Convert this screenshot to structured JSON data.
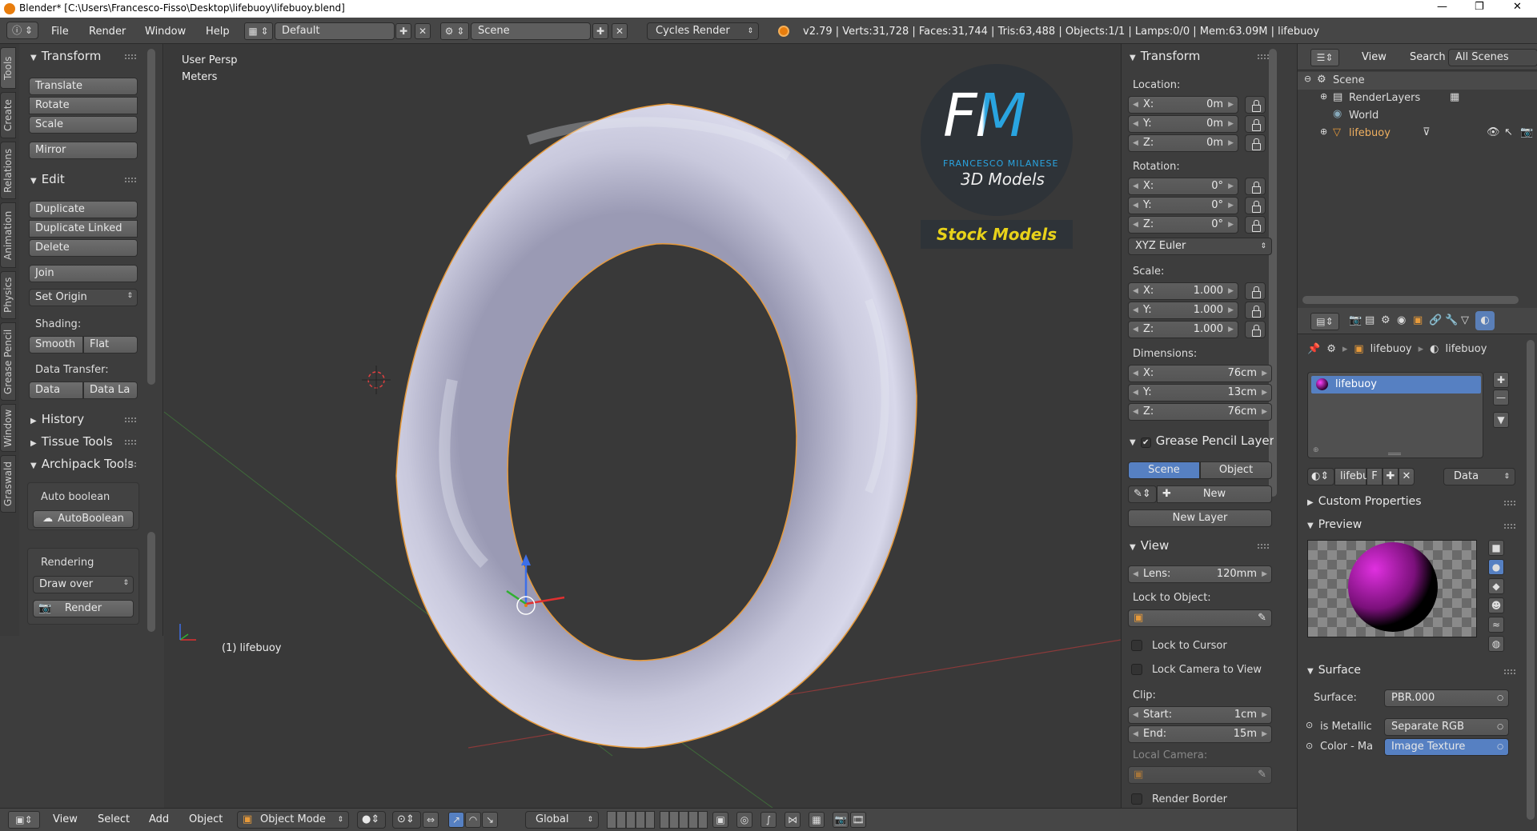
{
  "window": {
    "title": "Blender* [C:\\Users\\Francesco-Fisso\\Desktop\\lifebuoy\\lifebuoy.blend]",
    "min": "—",
    "max": "❐",
    "close": "✕"
  },
  "menubar": {
    "items": [
      "File",
      "Render",
      "Window",
      "Help"
    ],
    "layout": "Default",
    "scene": "Scene",
    "engine": "Cycles Render",
    "stats": "v2.79 | Verts:31,728 | Faces:31,744 | Tris:63,488 | Objects:1/1 | Lamps:0/0 | Mem:63.09M | lifebuoy"
  },
  "tools_tabs": [
    "Tools",
    "Create",
    "Relations",
    "Animation",
    "Physics",
    "Grease Pencil",
    "Window",
    "Graswald"
  ],
  "tools": {
    "transform_header": "Transform",
    "translate": "Translate",
    "rotate": "Rotate",
    "scale": "Scale",
    "mirror": "Mirror",
    "edit_header": "Edit",
    "duplicate": "Duplicate",
    "duplicate_linked": "Duplicate Linked",
    "delete": "Delete",
    "join": "Join",
    "set_origin": "Set Origin",
    "shading_label": "Shading:",
    "smooth": "Smooth",
    "flat": "Flat",
    "data_transfer_label": "Data Transfer:",
    "data": "Data",
    "data_la": "Data La",
    "history": "History",
    "tissue": "Tissue Tools",
    "archipack": "Archipack Tools",
    "auto_boolean_label": "Auto boolean",
    "auto_boolean_btn": "AutoBoolean",
    "rendering_label": "Rendering",
    "draw_over": "Draw over",
    "render": "Render"
  },
  "viewport": {
    "view_name": "User Persp",
    "units": "Meters",
    "object_label": "(1) lifebuoy",
    "watermark": {
      "letters": "FM",
      "name": "FRANCESCO MILANESE",
      "sub": "3D Models",
      "stock": "Stock Models"
    }
  },
  "properties_panel": {
    "transform_header": "Transform",
    "location_label": "Location:",
    "loc_x": "0m",
    "loc_y": "0m",
    "loc_z": "0m",
    "rotation_label": "Rotation:",
    "rot_x": "0°",
    "rot_y": "0°",
    "rot_z": "0°",
    "rotation_mode": "XYZ Euler",
    "scale_label": "Scale:",
    "scale_x": "1.000",
    "scale_y": "1.000",
    "scale_z": "1.000",
    "dimensions_label": "Dimensions:",
    "dim_x": "76cm",
    "dim_y": "13cm",
    "dim_z": "76cm",
    "x": "X:",
    "y": "Y:",
    "z": "Z:",
    "grease_header": "Grease Pencil Layer",
    "gp_scene": "Scene",
    "gp_object": "Object",
    "gp_new": "New",
    "gp_new_layer": "New Layer",
    "view_header": "View",
    "lens_label": "Lens:",
    "lens_value": "120mm",
    "lock_to_object": "Lock to Object:",
    "lock_to_cursor": "Lock to Cursor",
    "lock_camera": "Lock Camera to View",
    "clip_label": "Clip:",
    "clip_start_label": "Start:",
    "clip_start": "1cm",
    "clip_end_label": "End:",
    "clip_end": "15m",
    "local_camera": "Local Camera:",
    "render_border": "Render Border"
  },
  "outliner": {
    "view": "View",
    "search": "Search",
    "filter": "All Scenes",
    "scene": "Scene",
    "renderlayers": "RenderLayers",
    "world": "World",
    "object": "lifebuoy"
  },
  "material": {
    "breadcrumb_obj": "lifebuoy",
    "breadcrumb_mat": "lifebuoy",
    "slot": "lifebuoy",
    "mat_name": "lifebu",
    "f": "F",
    "data_select": "Data",
    "custom_props": "Custom Properties",
    "preview": "Preview",
    "surface_header": "Surface",
    "surface_label": "Surface:",
    "surface_value": "PBR.000",
    "metallic_label": "is Metallic",
    "metallic_value": "Separate RGB",
    "color_label": "Color - Ma",
    "color_value": "Image Texture"
  },
  "bottom": {
    "view": "View",
    "select": "Select",
    "add": "Add",
    "object": "Object",
    "mode": "Object Mode",
    "orientation": "Global"
  },
  "colors": {
    "selected": "#5680c2",
    "orange": "#f0a040",
    "accent_blue": "#29a4e0",
    "accent_yellow": "#e8d21a"
  }
}
